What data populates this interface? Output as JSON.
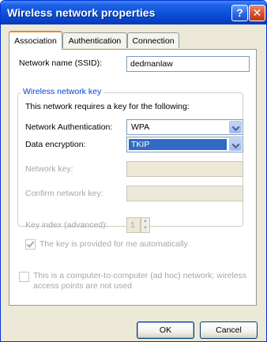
{
  "window": {
    "title": "Wireless network properties",
    "help_glyph": "?",
    "close_glyph": "✕"
  },
  "tabs": [
    {
      "label": "Association",
      "active": true
    },
    {
      "label": "Authentication",
      "active": false
    },
    {
      "label": "Connection",
      "active": false
    }
  ],
  "association": {
    "ssid_label": "Network name (SSID):",
    "ssid_value": "dedmanlaw",
    "group_title": "Wireless network key",
    "key_required_text": "This network requires a key for the following:",
    "auth_label": "Network Authentication:",
    "auth_value": "WPA",
    "encryption_label": "Data encryption:",
    "encryption_value": "TKIP",
    "network_key_label": "Network key:",
    "network_key_value": "",
    "confirm_key_label": "Confirm network key:",
    "confirm_key_value": "",
    "key_index_label": "Key index (advanced):",
    "key_index_value": "1",
    "auto_key_label": "The key is provided for me automatically",
    "auto_key_checked": true,
    "adhoc_label_line1": "This is a computer-to-computer (ad hoc) network; wireless",
    "adhoc_label_line2": "access points are not used",
    "adhoc_checked": false
  },
  "buttons": {
    "ok": "OK",
    "cancel": "Cancel"
  }
}
